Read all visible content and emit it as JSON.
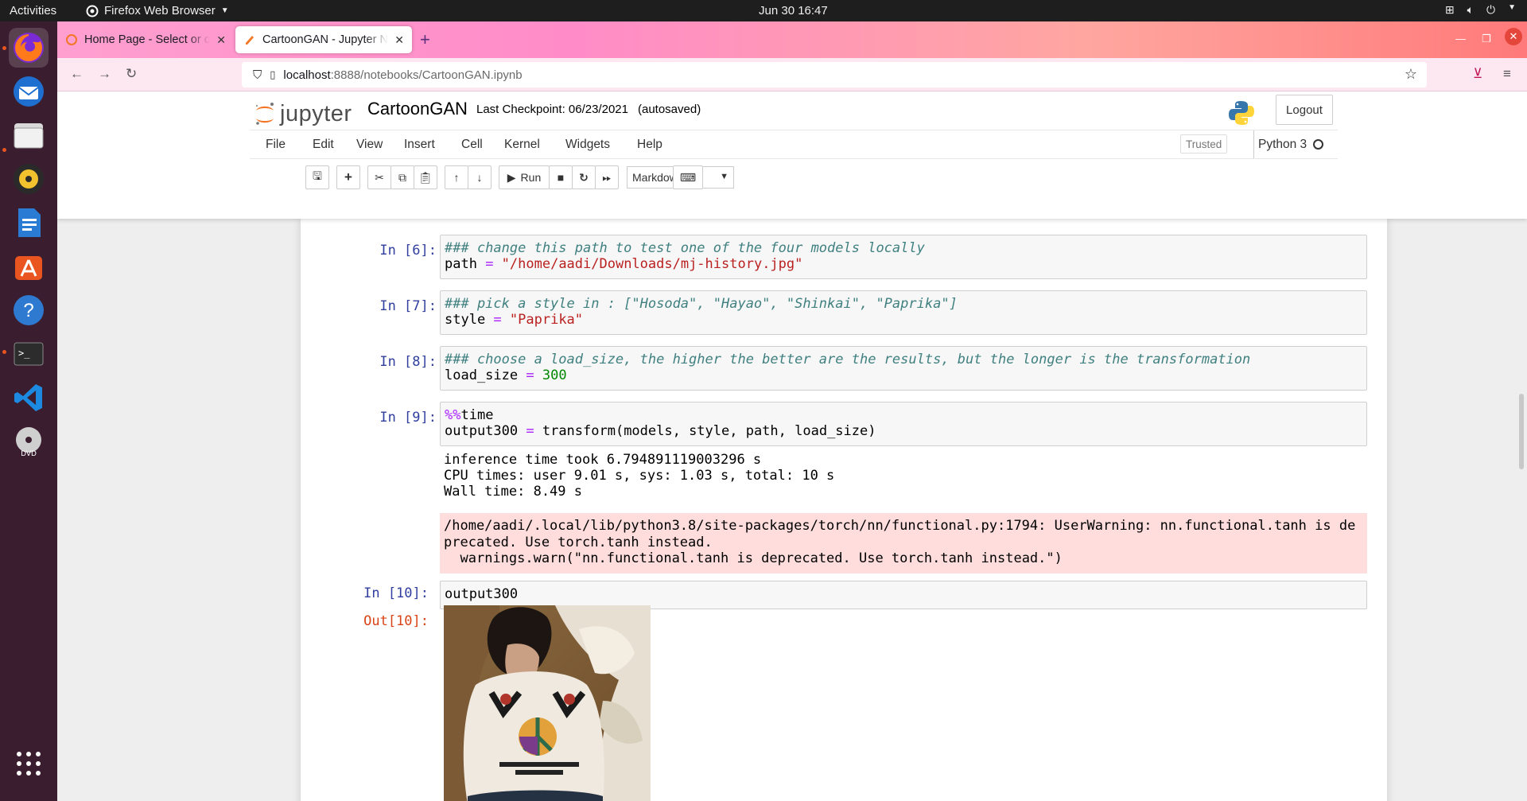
{
  "system": {
    "activities_label": "Activities",
    "app_menu_label": "Firefox Web Browser",
    "clock": "Jun 30  16:47"
  },
  "browser": {
    "tabs": [
      {
        "label": "Home Page - Select or create a notebook",
        "active": false
      },
      {
        "label": "CartoonGAN - Jupyter Notebook",
        "active": true
      }
    ],
    "url_host": "localhost",
    "url_path": ":8888/notebooks/CartoonGAN.ipynb"
  },
  "jupyter": {
    "logo_text": "jupyter",
    "notebook_title": "CartoonGAN",
    "checkpoint_label": "Last Checkpoint: 06/23/2021",
    "autosave_status": "(autosaved)",
    "logout_label": "Logout",
    "menu": [
      "File",
      "Edit",
      "View",
      "Insert",
      "Cell",
      "Kernel",
      "Widgets",
      "Help"
    ],
    "trusted_label": "Trusted",
    "kernel_name": "Python 3",
    "run_label": "Run",
    "cell_type": "Markdown"
  },
  "cells": {
    "c6": {
      "prompt": "In [6]:",
      "comment": "### change this path to test one of the four models locally",
      "var": "path",
      "op": " = ",
      "value": "\"/home/aadi/Downloads/mj-history.jpg\""
    },
    "c7": {
      "prompt": "In [7]:",
      "comment": "### pick a style in : [\"Hosoda\", \"Hayao\", \"Shinkai\", \"Paprika\"]",
      "var": "style",
      "op": " = ",
      "value": "\"Paprika\""
    },
    "c8": {
      "prompt": "In [8]:",
      "comment": "### choose a load_size, the higher the better are the results, but the longer is the transformation",
      "var": "load_size",
      "op": " = ",
      "value": "300"
    },
    "c9": {
      "prompt": "In [9]:",
      "magic": "%%",
      "magic_rest": "time",
      "line2_var": "output300",
      "line2_op": " = ",
      "line2_rest": "transform(models, style, path, load_size)",
      "stdout": "inference time took 6.794891119003296 s\nCPU times: user 9.01 s, sys: 1.03 s, total: 10 s\nWall time: 8.49 s",
      "stderr": "/home/aadi/.local/lib/python3.8/site-packages/torch/nn/functional.py:1794: UserWarning: nn.functional.tanh is deprecated. Use torch.tanh instead.\n  warnings.warn(\"nn.functional.tanh is deprecated. Use torch.tanh instead.\")"
    },
    "c10": {
      "prompt": "In [10]:",
      "code": "output300",
      "out_prompt": "Out[10]:"
    }
  }
}
